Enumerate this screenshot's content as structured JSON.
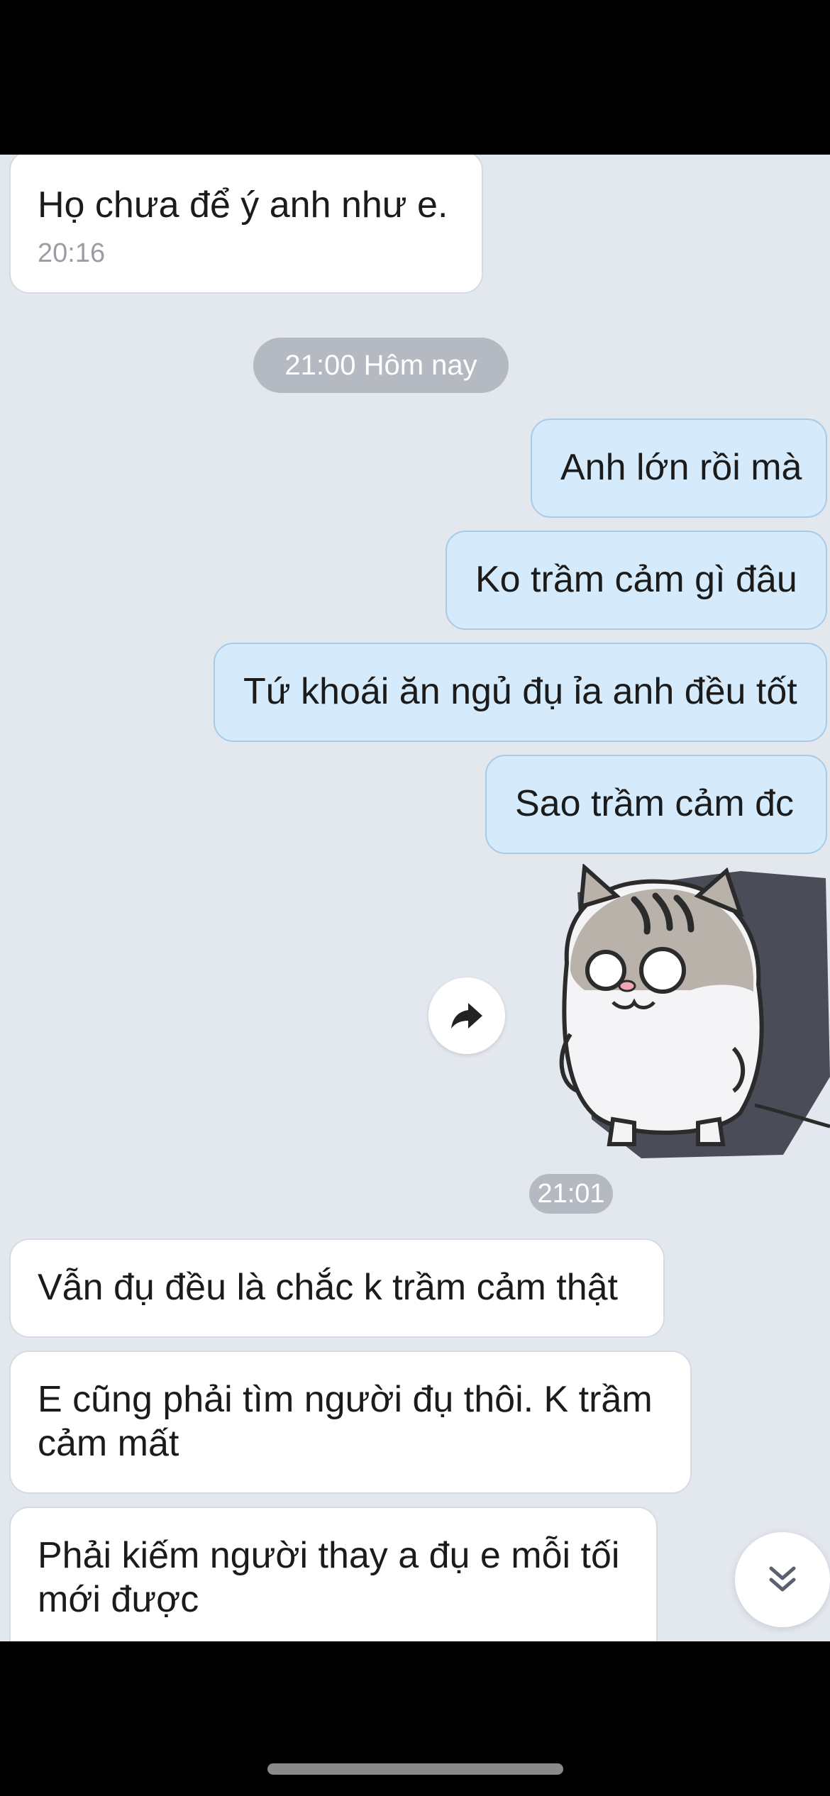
{
  "messages": [
    {
      "side": "in",
      "text": "Họ chưa để ý anh như e.",
      "time": "20:16"
    },
    {
      "side": "out",
      "text": "Anh lớn rồi mà"
    },
    {
      "side": "out",
      "text": "Ko trầm cảm gì đâu"
    },
    {
      "side": "out",
      "text": "Tứ khoái ăn ngủ đụ ỉa anh đều tốt"
    },
    {
      "side": "out",
      "text": "Sao trầm cảm đc"
    },
    {
      "side": "in",
      "text": "Vẫn đụ đều là chắc k trầm cảm thật"
    },
    {
      "side": "in",
      "text": "E cũng phải tìm người đụ thôi. K trầm cảm mất"
    },
    {
      "side": "in",
      "text": "Phải kiếm người thay a đụ e mỗi tối mới được"
    }
  ],
  "date_separator": "21:00 Hôm nay",
  "sticker": {
    "time": "21:01",
    "icon": "cat-sticker"
  },
  "icons": {
    "share": "share-arrow-icon",
    "scroll": "double-chevron-down-icon"
  },
  "colors": {
    "incoming_bubble": "#ffffff",
    "outgoing_bubble": "#d5ebfb",
    "chat_background": "#e3e7ee"
  }
}
